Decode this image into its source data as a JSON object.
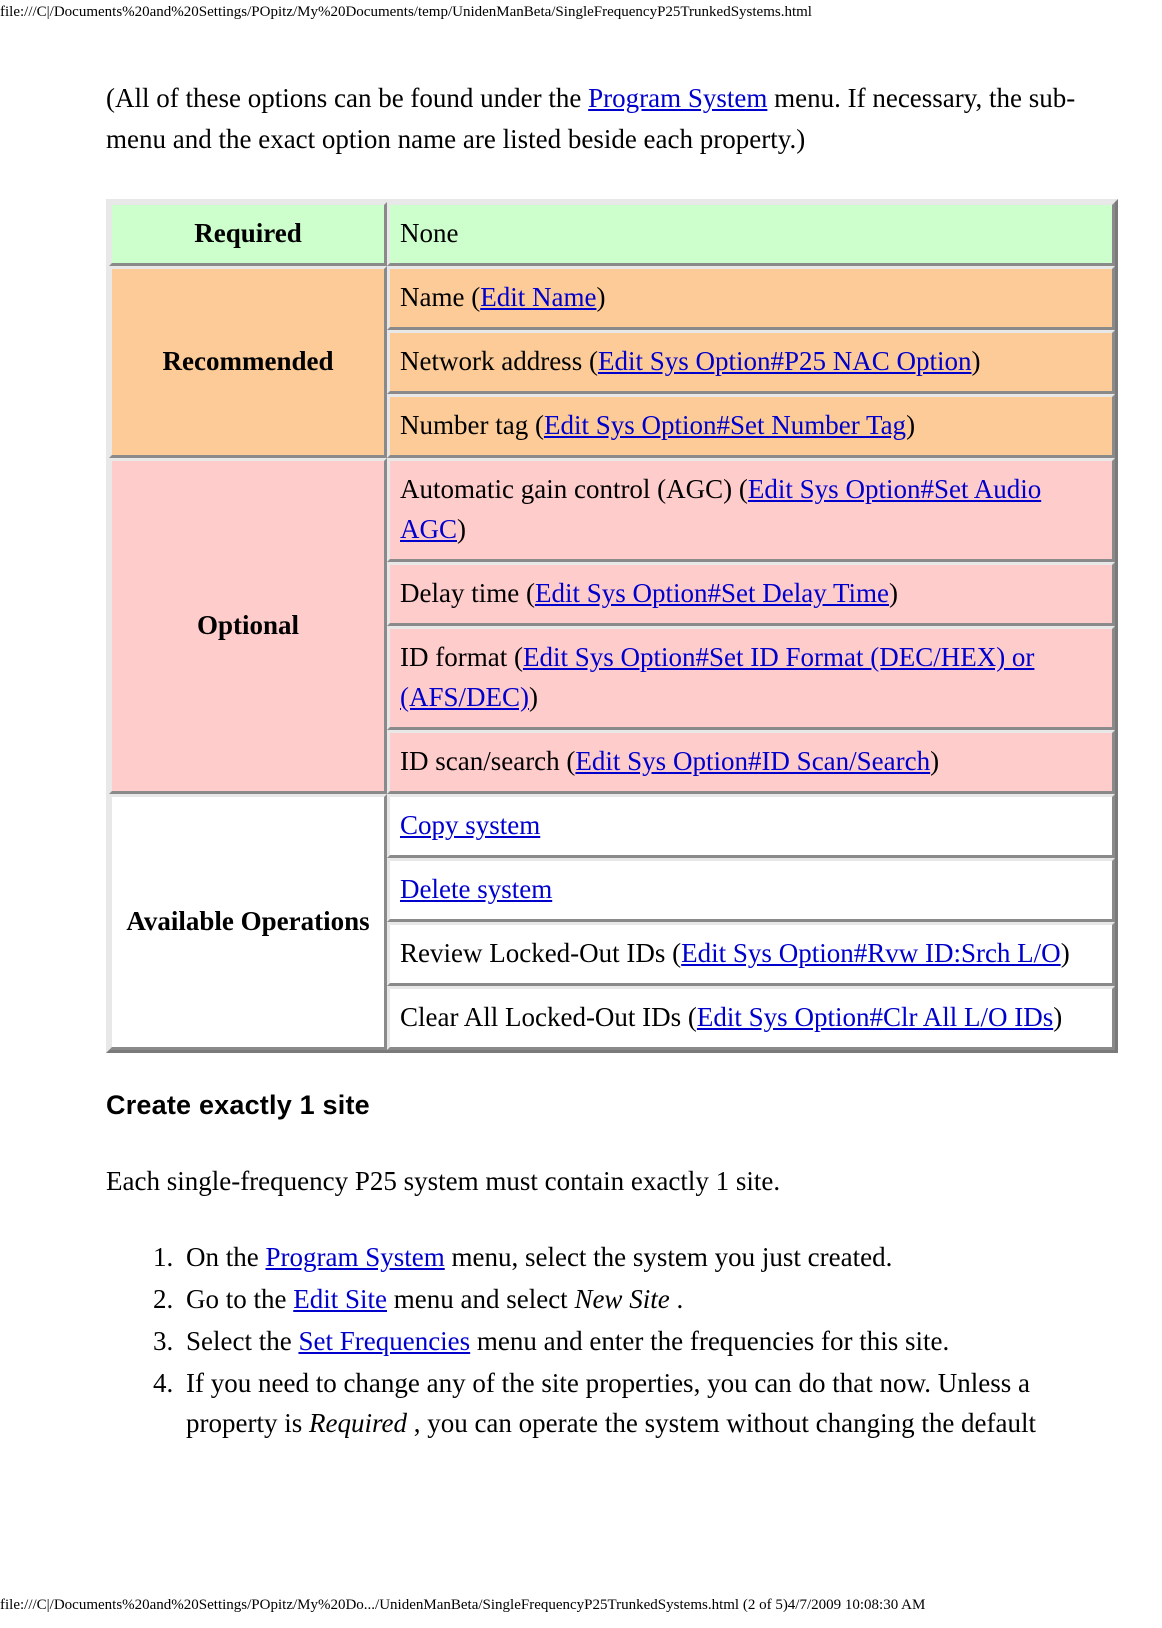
{
  "header": {
    "url": "file:///C|/Documents%20and%20Settings/POpitz/My%20Documents/temp/UnidenManBeta/SingleFrequencyP25TrunkedSystems.html"
  },
  "footer": {
    "url": "file:///C|/Documents%20and%20Settings/POpitz/My%20Do.../UnidenManBeta/SingleFrequencyP25TrunkedSystems.html (2 of 5)4/7/2009 10:08:30 AM"
  },
  "intro": {
    "before_link": "(All of these options can be found under the ",
    "link": "Program System",
    "after_link": " menu. If necessary, the sub-menu and the exact option name are listed beside each property.)"
  },
  "colors": {
    "required_bg": "#ccffcc",
    "recommended_bg": "#fccb98",
    "optional_bg": "#ffcccc",
    "operations_bg": "#ffffff",
    "link": "#0000cc"
  },
  "table": {
    "rows": [
      {
        "category": "Required",
        "style": "bg-green",
        "items": [
          {
            "pre": "None",
            "link": "",
            "post": ""
          }
        ]
      },
      {
        "category": "Recommended",
        "style": "bg-orange",
        "items": [
          {
            "pre": "Name (",
            "link": "Edit Name",
            "post": ")"
          },
          {
            "pre": "Network address (",
            "link": "Edit Sys Option#P25 NAC Option",
            "post": ")"
          },
          {
            "pre": "Number tag (",
            "link": "Edit Sys Option#Set Number Tag",
            "post": ")"
          }
        ]
      },
      {
        "category": "Optional",
        "style": "bg-pink",
        "items": [
          {
            "pre": "Automatic gain control (AGC) (",
            "link": "Edit Sys Option#Set Audio AGC",
            "post": ")"
          },
          {
            "pre": "Delay time (",
            "link": "Edit Sys Option#Set Delay Time",
            "post": ")"
          },
          {
            "pre": "ID format (",
            "link": "Edit Sys Option#Set ID Format (DEC/HEX) or (AFS/DEC)",
            "post": ")"
          },
          {
            "pre": "ID scan/search (",
            "link": "Edit Sys Option#ID Scan/Search",
            "post": ")"
          }
        ]
      },
      {
        "category": "Available Operations",
        "style": "bg-white",
        "items": [
          {
            "pre": "",
            "link": "Copy system",
            "post": ""
          },
          {
            "pre": "",
            "link": "Delete system",
            "post": ""
          },
          {
            "pre": "Review Locked-Out IDs (",
            "link": "Edit Sys Option#Rvw ID:Srch L/O",
            "post": ")"
          },
          {
            "pre": "Clear All Locked-Out IDs (",
            "link": "Edit Sys Option#Clr All L/O IDs",
            "post": ")"
          }
        ]
      }
    ]
  },
  "section": {
    "heading": "Create exactly 1 site",
    "paragraph": "Each single-frequency P25 system must contain exactly 1 site."
  },
  "steps": [
    {
      "pre": "On the ",
      "link": "Program System",
      "mid": " menu, select the system you just created.",
      "em": "",
      "post": ""
    },
    {
      "pre": "Go to the ",
      "link": "Edit Site",
      "mid": " menu and select ",
      "em": "New Site",
      "post": " ."
    },
    {
      "pre": "Select the ",
      "link": "Set Frequencies",
      "mid": " menu and enter the frequencies for this site.",
      "em": "",
      "post": ""
    },
    {
      "pre": "If you need to change any of the site properties, you can do that now. Unless a property is ",
      "link": "",
      "mid": "",
      "em": "Required",
      "post": " , you can operate the system without changing the default"
    }
  ]
}
